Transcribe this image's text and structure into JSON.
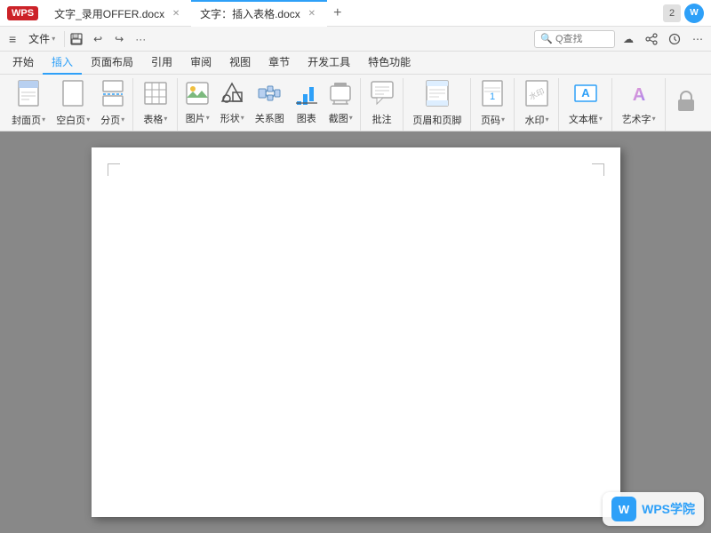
{
  "titlebar": {
    "wps_logo": "WPS",
    "tab1_label": "文字_录用OFFER.docx",
    "tab2_label": "文字：插入表格.docx",
    "tab_add": "+",
    "btn_count": "2",
    "user_initial": "W"
  },
  "menubar": {
    "menu_icon": "≡",
    "file_label": "文件",
    "file_caret": "▾",
    "undo_icon": "↩",
    "redo_icon": "↪",
    "more_icon": "···",
    "search_placeholder": "Q查找",
    "cloud_icon": "☁",
    "share_icon": "↗",
    "history_icon": "🕐",
    "more_btn": "⋯"
  },
  "ribbon": {
    "tabs": [
      {
        "label": "开始",
        "active": false
      },
      {
        "label": "插入",
        "active": true
      },
      {
        "label": "页面布局",
        "active": false
      },
      {
        "label": "引用",
        "active": false
      },
      {
        "label": "审阅",
        "active": false
      },
      {
        "label": "视图",
        "active": false
      },
      {
        "label": "章节",
        "active": false
      },
      {
        "label": "开发工具",
        "active": false
      },
      {
        "label": "特色功能",
        "active": false
      }
    ],
    "groups": [
      {
        "label": "",
        "items": [
          {
            "icon": "📄",
            "label": "封面页",
            "caret": true
          },
          {
            "icon": "📄",
            "label": "空白页",
            "caret": true
          },
          {
            "icon": "✂",
            "label": "分页",
            "caret": true
          }
        ]
      },
      {
        "label": "",
        "items": [
          {
            "icon": "⊞",
            "label": "表格",
            "caret": true
          }
        ]
      },
      {
        "label": "",
        "items": [
          {
            "icon": "🖼",
            "label": "图片",
            "caret": true
          },
          {
            "icon": "⬠",
            "label": "形状",
            "caret": true
          },
          {
            "icon": "☁",
            "label": "关系图",
            "caret": false
          },
          {
            "icon": "📊",
            "label": "图表",
            "caret": false
          },
          {
            "icon": "✂",
            "label": "截图",
            "caret": true
          }
        ]
      },
      {
        "label": "",
        "items": [
          {
            "icon": "💬",
            "label": "批注",
            "caret": false
          }
        ]
      },
      {
        "label": "",
        "items": [
          {
            "icon": "Ａ",
            "label": "页眉和页脚",
            "caret": false
          }
        ]
      },
      {
        "label": "",
        "items": [
          {
            "icon": "#",
            "label": "页码",
            "caret": true
          }
        ]
      },
      {
        "label": "",
        "items": [
          {
            "icon": "≋",
            "label": "水印",
            "caret": true
          }
        ]
      },
      {
        "label": "",
        "items": [
          {
            "icon": "A",
            "label": "文本框",
            "caret": true
          }
        ]
      },
      {
        "label": "",
        "items": [
          {
            "icon": "A",
            "label": "艺术字",
            "caret": true
          }
        ]
      },
      {
        "label": "",
        "items": [
          {
            "icon": "🔒",
            "label": "",
            "caret": false
          }
        ]
      }
    ]
  },
  "document": {
    "background": "#888888",
    "page_background": "#ffffff"
  },
  "wps_academy": {
    "logo": "W",
    "label": "WPS学院"
  }
}
